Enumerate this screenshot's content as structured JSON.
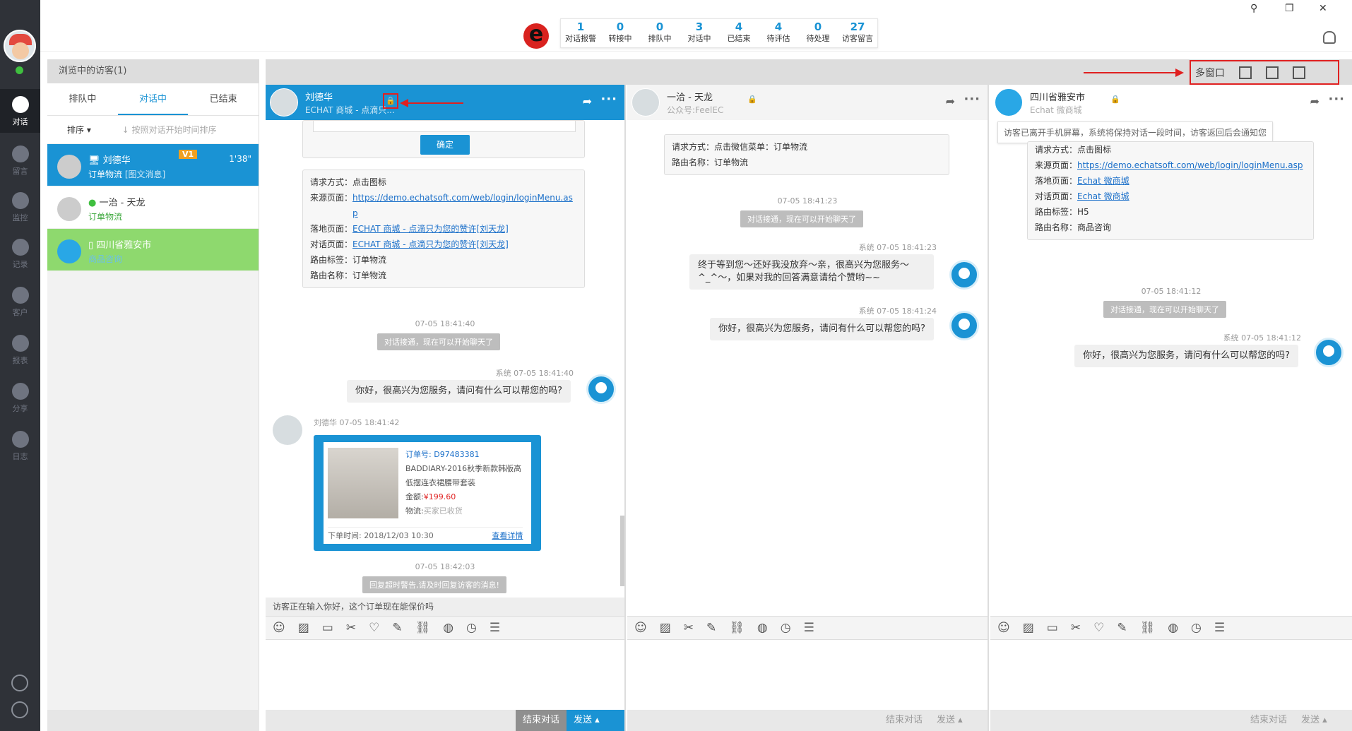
{
  "rail": {
    "items": [
      {
        "label": "对话",
        "icon": "chat-icon",
        "active": true
      },
      {
        "label": "留言",
        "icon": "mail-icon"
      },
      {
        "label": "监控",
        "icon": "eye-icon"
      },
      {
        "label": "记录",
        "icon": "clock-icon"
      },
      {
        "label": "客户",
        "icon": "contact-card-icon"
      },
      {
        "label": "报表",
        "icon": "pie-chart-icon"
      },
      {
        "label": "分享",
        "icon": "share-icon"
      },
      {
        "label": "日志",
        "icon": "clipboard-icon"
      }
    ]
  },
  "topbar": {
    "logo": "e",
    "stats": [
      {
        "n": "1",
        "t": "对话报警"
      },
      {
        "n": "0",
        "t": "转接中"
      },
      {
        "n": "0",
        "t": "排队中"
      },
      {
        "n": "3",
        "t": "对话中"
      },
      {
        "n": "4",
        "t": "已结束"
      },
      {
        "n": "4",
        "t": "待评估"
      },
      {
        "n": "0",
        "t": "待处理"
      },
      {
        "n": "27",
        "t": "访客留言"
      }
    ],
    "win": {
      "pin": "⚲",
      "restore": "❐",
      "close": "✕"
    }
  },
  "visitors": {
    "header": "浏览中的访客(1)",
    "tabs": [
      "排队中",
      "对话中",
      "已结束"
    ],
    "sort_label": "排序 ▾",
    "sort_hint": "↓ 按照对话开始时间排序",
    "items": [
      {
        "name": "刘德华",
        "sub": "订单物流",
        "sub2": "[图文消息]",
        "time": "1'38\"",
        "badge": "V1"
      },
      {
        "name": "一治 - 天龙",
        "sub": "订单物流"
      },
      {
        "name": "四川省雅安市",
        "sub": "商品咨询"
      }
    ]
  },
  "multi": {
    "label": "多窗口"
  },
  "panes": [
    {
      "name": "刘德华",
      "sub": "ECHAT 商城 - 点滴只...",
      "confirm": "确定",
      "info": [
        {
          "k": "请求方式：",
          "v": "点击图标"
        },
        {
          "k": "来源页面：",
          "v": "https://demo.echatsoft.com/web/login/loginMenu.asp",
          "link": true
        },
        {
          "k": "落地页面：",
          "v": "ECHAT 商城 - 点滴只为您的赞许[刘天龙]",
          "link": true
        },
        {
          "k": "对话页面：",
          "v": "ECHAT 商城 - 点滴只为您的赞许[刘天龙]",
          "link": true
        },
        {
          "k": "路由标签：",
          "v": "订单物流"
        },
        {
          "k": "路由名称：",
          "v": "订单物流"
        }
      ],
      "ts1": "07-05 18:41:40",
      "sys1": "对话接通，现在可以开始聊天了",
      "meta1": "系统 07-05 18:41:40",
      "msg1": "你好，很高兴为您服务，请问有什么可以帮您的吗?",
      "meta2": "刘德华 07-05 18:41:42",
      "order": {
        "no_label": "订单号:",
        "no": "D97483381",
        "title": "BADDIARY-2016秋季新款韩版高低摆连衣裙腰带套装",
        "amount_label": "金额:",
        "amount": "¥199.60",
        "logistics_label": "物流:",
        "logistics": "买家已收货",
        "time": "下单时间: 2018/12/03 10:30",
        "detail": "查看详情"
      },
      "ts2": "07-05 18:42:03",
      "sys2": "回复超时警告,请及时回复访客的消息!",
      "typing": "访客正在输入你好，这个订单现在能保价吗",
      "end": "结束对话",
      "send": "发送"
    },
    {
      "name": "一洽 - 天龙",
      "sub": "公众号:FeelEC",
      "info": [
        {
          "k": "请求方式：",
          "v": "点击微信菜单：订单物流"
        },
        {
          "k": "路由名称：",
          "v": "订单物流"
        }
      ],
      "ts1": "07-05 18:41:23",
      "sys1": "对话接通，现在可以开始聊天了",
      "meta1": "系统 07-05 18:41:23",
      "msg1": "终于等到您～还好我没放弃～亲，很高兴为您服务～^_^～，如果对我的回答满意请给个赞哟~~",
      "meta2": "系统 07-05 18:41:24",
      "msg2": "你好，很高兴为您服务，请问有什么可以帮您的吗?",
      "end": "结束对话",
      "send": "发送"
    },
    {
      "name": "四川省雅安市",
      "sub": "Echat 微商城",
      "notice": "访客已离开手机屏幕，系统将保持对话一段时间，访客返回后会通知您",
      "info": [
        {
          "k": "请求方式：",
          "v": "点击图标"
        },
        {
          "k": "来源页面：",
          "v": "https://demo.echatsoft.com/web/login/loginMenu.asp",
          "link": true
        },
        {
          "k": "落地页面：",
          "v": "Echat 微商城",
          "link": true
        },
        {
          "k": "对话页面：",
          "v": "Echat 微商城",
          "link": true
        },
        {
          "k": "路由标签：",
          "v": "H5"
        },
        {
          "k": "路由名称：",
          "v": "商品咨询"
        }
      ],
      "ts1": "07-05 18:41:12",
      "sys1": "对话接通，现在可以开始聊天了",
      "meta1": "系统 07-05 18:41:12",
      "msg1": "你好，很高兴为您服务，请问有什么可以帮您的吗?",
      "end": "结束对话",
      "send": "发送"
    }
  ],
  "toolbar_icons": [
    "emoji-icon",
    "image-icon",
    "folder-icon",
    "scissors-icon",
    "heart-icon",
    "edit-icon",
    "link-icon",
    "globe-icon",
    "clock-icon",
    "list-icon"
  ]
}
